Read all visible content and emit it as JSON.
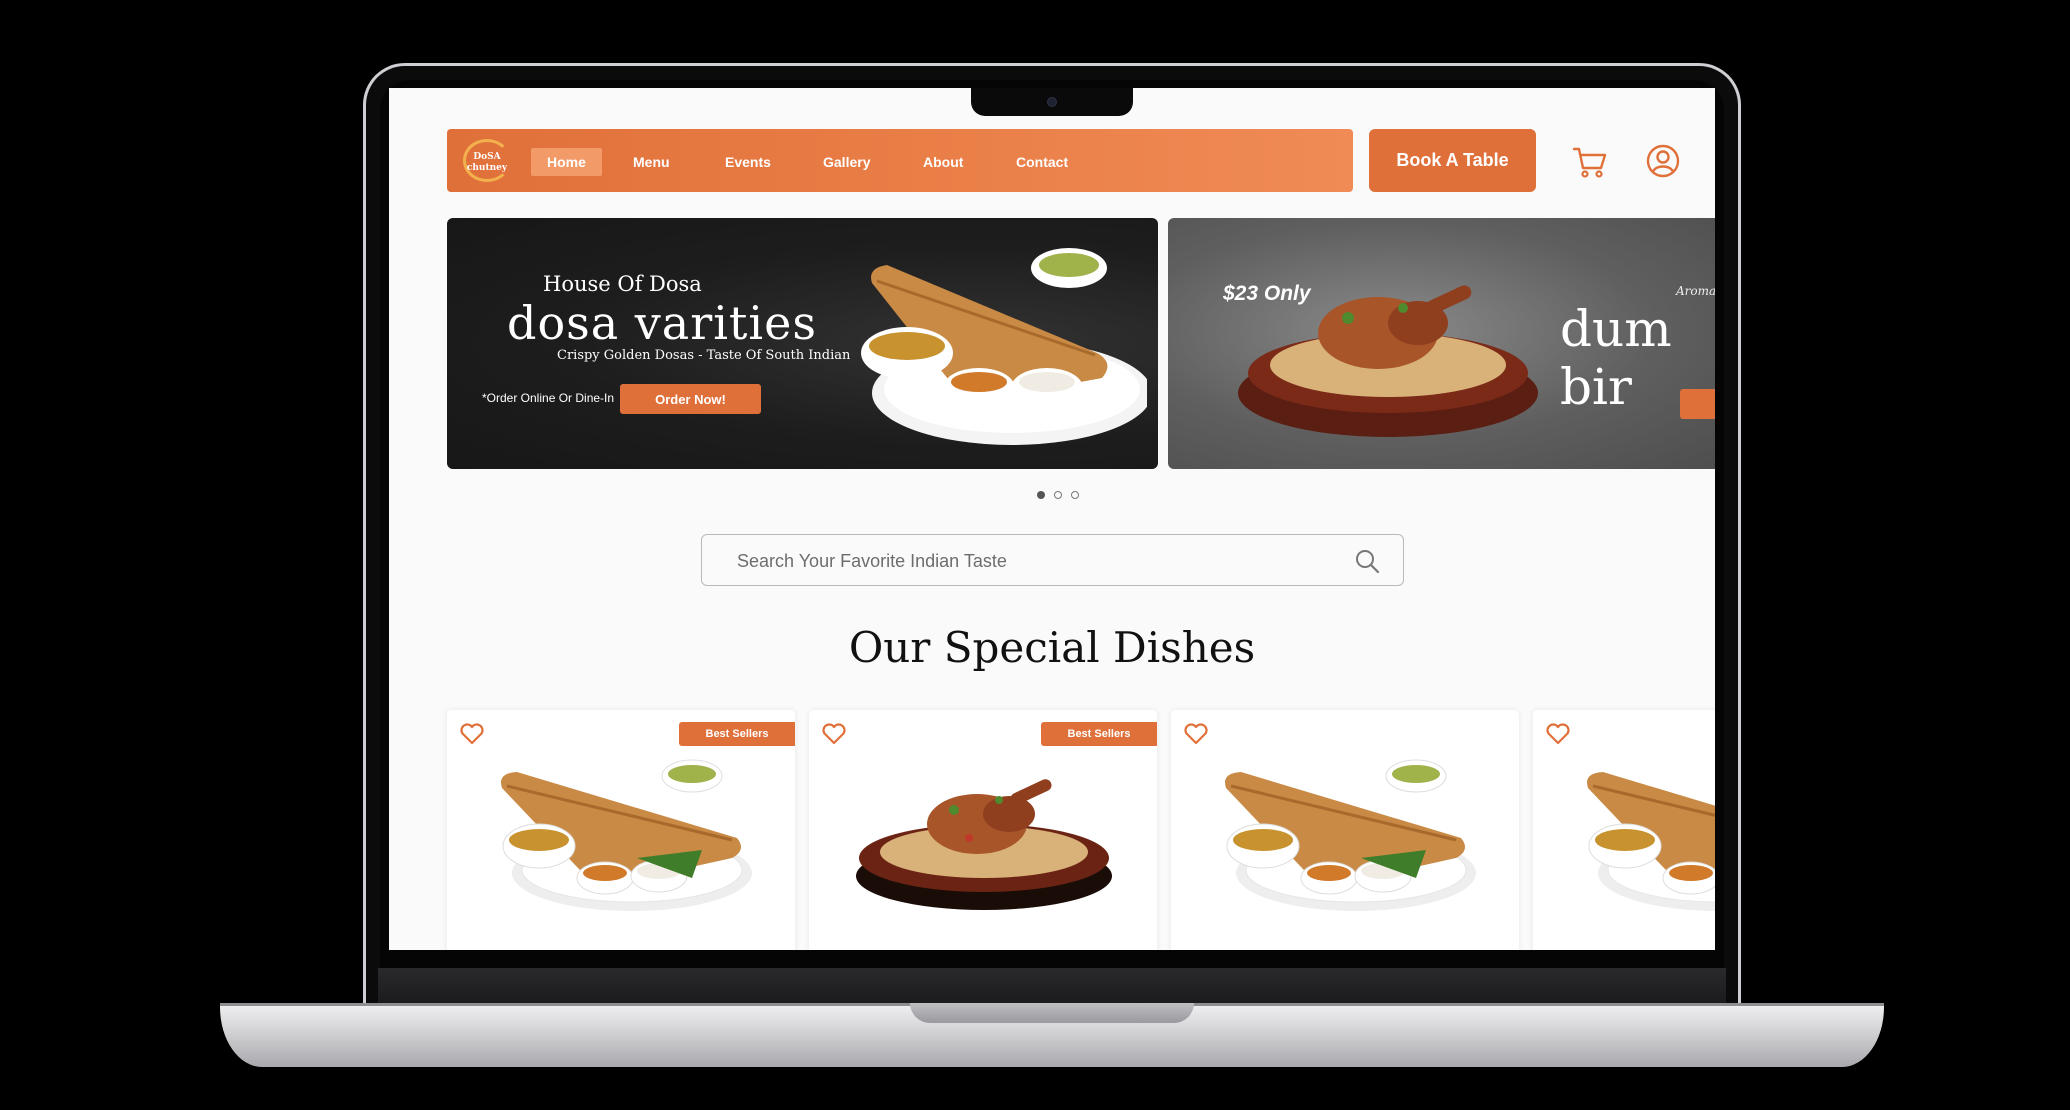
{
  "brand": {
    "logo_text": "DoSA\nchutney",
    "accent_color": "#e0703a"
  },
  "nav": {
    "items": [
      {
        "label": "Home",
        "active": true
      },
      {
        "label": "Menu",
        "active": false
      },
      {
        "label": "Events",
        "active": false
      },
      {
        "label": "Gallery",
        "active": false
      },
      {
        "label": "About",
        "active": false
      },
      {
        "label": "Contact",
        "active": false
      }
    ],
    "book_label": "Book A Table",
    "cart_icon": "cart-icon",
    "user_icon": "user-icon"
  },
  "banners": [
    {
      "small_title": "House Of Dosa",
      "big_title": "dosa varities",
      "subtitle": "Crispy Golden Dosas - Taste Of South Indian",
      "note": "*Order Online Or Dine-In",
      "cta": "Order Now!"
    },
    {
      "price": "$23 Only",
      "aroma": "Aroma",
      "big_title": "dum bir"
    }
  ],
  "carousel": {
    "count": 3,
    "active_index": 0
  },
  "search": {
    "placeholder": "Search Your Favorite Indian Taste"
  },
  "section": {
    "title": "Our Special Dishes"
  },
  "dishes": [
    {
      "type": "dosa",
      "badge": "Best Sellers"
    },
    {
      "type": "biryani",
      "badge": "Best Sellers"
    },
    {
      "type": "dosa",
      "badge": ""
    },
    {
      "type": "dosa",
      "badge": ""
    }
  ]
}
